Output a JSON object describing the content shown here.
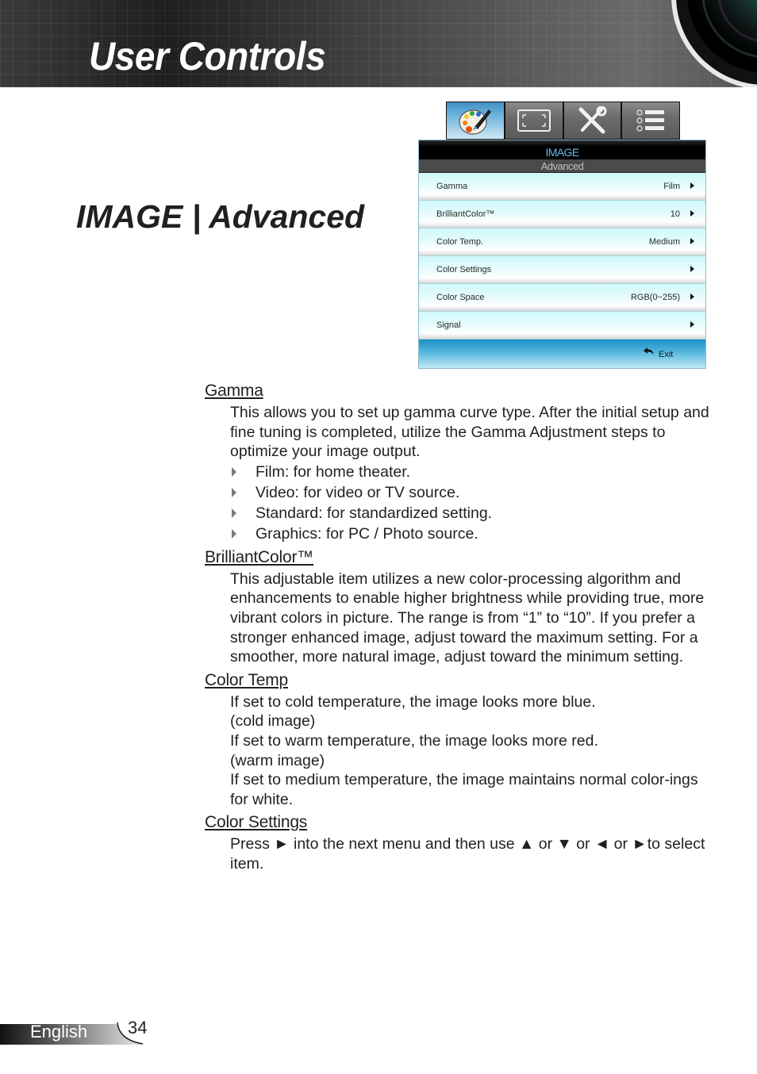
{
  "header": {
    "title": "User Controls"
  },
  "section_title": "IMAGE | Advanced",
  "osd": {
    "tabs": [
      {
        "name": "image",
        "icon": "palette-icon",
        "active": true
      },
      {
        "name": "display",
        "icon": "screen-frame-icon",
        "active": false
      },
      {
        "name": "setup",
        "icon": "tools-icon",
        "active": false
      },
      {
        "name": "options",
        "icon": "list-icon",
        "active": false
      }
    ],
    "menu_title": "IMAGE",
    "submenu_title": "Advanced",
    "rows": [
      {
        "label": "Gamma",
        "value": "Film"
      },
      {
        "label": "BrilliantColor™",
        "value": "10"
      },
      {
        "label": "Color Temp.",
        "value": "Medium"
      },
      {
        "label": "Color Settings",
        "value": ""
      },
      {
        "label": "Color Space",
        "value": "RGB(0~255)"
      },
      {
        "label": "Signal",
        "value": ""
      }
    ],
    "exit_label": "Exit"
  },
  "sections": {
    "gamma": {
      "heading": "Gamma",
      "body": "This allows you to set up gamma curve type. After the initial setup and fine tuning is completed, utilize the Gamma Adjustment steps to optimize your image output.",
      "bullets": [
        "Film: for home theater.",
        "Video: for video or TV source.",
        "Standard: for standardized setting.",
        "Graphics: for PC / Photo source."
      ]
    },
    "brilliantcolor": {
      "heading": "BrilliantColor™",
      "body": "This adjustable item utilizes a new color-processing algorithm and enhancements to enable higher brightness while providing true, more vibrant colors in picture. The range is from “1” to “10”. If you prefer a stronger enhanced image, adjust toward the maximum setting. For a smoother, more natural image, adjust toward the minimum setting."
    },
    "color_temp": {
      "heading": "Color Temp",
      "lines": [
        "If set to cold temperature, the image looks more blue.",
        "(cold image)",
        "If set to warm temperature, the image looks more red.",
        "(warm image)",
        "If set to medium temperature, the image maintains normal color-ings for white."
      ]
    },
    "color_settings": {
      "heading": "Color Settings",
      "body": "Press ► into the next menu and then use ▲ or ▼ or ◄ or ►to select item."
    }
  },
  "footer": {
    "language": "English",
    "page_number": "34"
  }
}
